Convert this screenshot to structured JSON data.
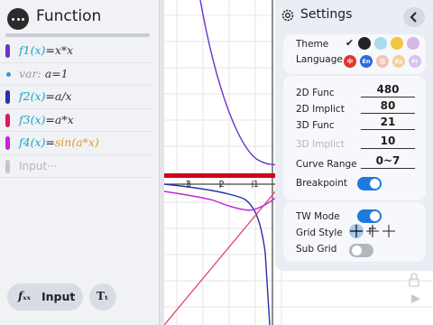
{
  "function_panel": {
    "title": "Function",
    "items": [
      {
        "name": "f1(x)",
        "eq": "=",
        "body": "x*x",
        "color": "#6a35c8"
      },
      {
        "name": "var:",
        "eq": "",
        "body": "a=1",
        "color": "#2e9bd6"
      },
      {
        "name": "f2(x)",
        "eq": "=",
        "body": "a/x",
        "color": "#2930a8"
      },
      {
        "name": "f3(x)",
        "eq": "=",
        "body": "a*x",
        "color": "#d61d5e"
      },
      {
        "name": "f4(x)",
        "eq": "=",
        "body": "sin(a*x)",
        "color": "#c126d6"
      },
      {
        "placeholder": "Input···",
        "color": "#b4b6bd"
      }
    ],
    "input_button": {
      "glyph": "fₓₓ",
      "label": "Input"
    },
    "text_button": {
      "glyph": "Tₜ"
    }
  },
  "graph": {
    "tick_labels": [
      "-3",
      "-2",
      "-1"
    ],
    "accent_color": "#d0021b"
  },
  "settings": {
    "title": "Settings",
    "theme_label": "Theme",
    "language_label": "Language",
    "theme_colors": [
      "#222222",
      "#a9dbe8",
      "#f3c441",
      "#d5b8e8"
    ],
    "languages": [
      "中",
      "En",
      "日",
      "Es",
      "Fr"
    ],
    "rows": [
      {
        "label": "2D Func",
        "value": "480"
      },
      {
        "label": "2D Implict",
        "value": "80"
      },
      {
        "label": "3D Func",
        "value": "21"
      },
      {
        "label": "3D Implict",
        "value": "10"
      },
      {
        "label": "Curve Range",
        "value": "0~7"
      }
    ],
    "breakpoint_label": "Breakpoint",
    "breakpoint_on": true,
    "tw_mode_label": "TW Mode",
    "tw_mode_on": true,
    "grid_style_label": "Grid Style",
    "sub_grid_label": "Sub Grid",
    "sub_grid_on": false
  }
}
